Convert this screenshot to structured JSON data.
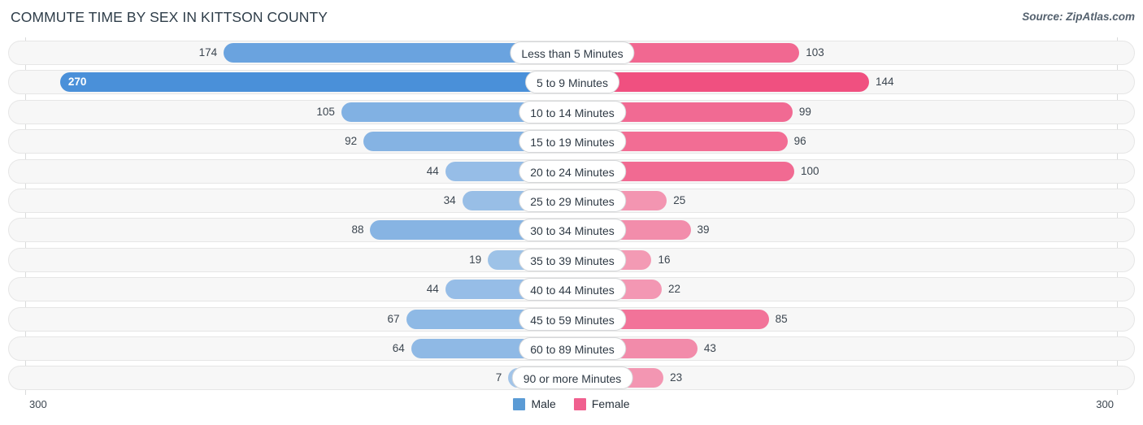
{
  "header": {
    "title": "COMMUTE TIME BY SEX IN KITTSON COUNTY",
    "source": "Source: ZipAtlas.com"
  },
  "axis": {
    "left_max": "300",
    "right_max": "300"
  },
  "legend": {
    "items": [
      {
        "label": "Male",
        "color": "#5b9bd5"
      },
      {
        "label": "Female",
        "color": "#f0608f"
      }
    ]
  },
  "chart_data": {
    "type": "bar",
    "title": "COMMUTE TIME BY SEX IN KITTSON COUNTY",
    "subtitle": "Source: ZipAtlas.com",
    "orientation": "horizontal-diverging",
    "xlabel": "",
    "ylabel": "",
    "xlim": [
      -300,
      300
    ],
    "axis_max": 300,
    "grid": false,
    "legend_position": "bottom-center",
    "categories": [
      "Less than 5 Minutes",
      "5 to 9 Minutes",
      "10 to 14 Minutes",
      "15 to 19 Minutes",
      "20 to 24 Minutes",
      "25 to 29 Minutes",
      "30 to 34 Minutes",
      "35 to 39 Minutes",
      "40 to 44 Minutes",
      "45 to 59 Minutes",
      "60 to 89 Minutes",
      "90 or more Minutes"
    ],
    "series": [
      {
        "name": "Male",
        "color": "#5b9bd5",
        "values": [
          174,
          270,
          105,
          92,
          44,
          34,
          88,
          19,
          44,
          67,
          64,
          7
        ]
      },
      {
        "name": "Female",
        "color": "#f0608f",
        "values": [
          103,
          144,
          99,
          96,
          100,
          25,
          39,
          16,
          22,
          85,
          43,
          23
        ]
      }
    ]
  },
  "rows": [
    {
      "label": "Less than 5 Minutes",
      "male": 174,
      "female": 103,
      "male_text": "174",
      "female_text": "103",
      "male_inside": false
    },
    {
      "label": "5 to 9 Minutes",
      "male": 270,
      "female": 144,
      "male_text": "270",
      "female_text": "144",
      "male_inside": true
    },
    {
      "label": "10 to 14 Minutes",
      "male": 105,
      "female": 99,
      "male_text": "105",
      "female_text": "99",
      "male_inside": false
    },
    {
      "label": "15 to 19 Minutes",
      "male": 92,
      "female": 96,
      "male_text": "92",
      "female_text": "96",
      "male_inside": false
    },
    {
      "label": "20 to 24 Minutes",
      "male": 44,
      "female": 100,
      "male_text": "44",
      "female_text": "100",
      "male_inside": false
    },
    {
      "label": "25 to 29 Minutes",
      "male": 34,
      "female": 25,
      "male_text": "34",
      "female_text": "25",
      "male_inside": false
    },
    {
      "label": "30 to 34 Minutes",
      "male": 88,
      "female": 39,
      "male_text": "88",
      "female_text": "39",
      "male_inside": false
    },
    {
      "label": "35 to 39 Minutes",
      "male": 19,
      "female": 16,
      "male_text": "19",
      "female_text": "16",
      "male_inside": false
    },
    {
      "label": "40 to 44 Minutes",
      "male": 44,
      "female": 22,
      "male_text": "44",
      "female_text": "22",
      "male_inside": false
    },
    {
      "label": "45 to 59 Minutes",
      "male": 67,
      "female": 85,
      "male_text": "67",
      "female_text": "85",
      "male_inside": false
    },
    {
      "label": "60 to 89 Minutes",
      "male": 64,
      "female": 43,
      "male_text": "64",
      "female_text": "43",
      "male_inside": false
    },
    {
      "label": "90 or more Minutes",
      "male": 7,
      "female": 23,
      "male_text": "7",
      "female_text": "23",
      "male_inside": false
    }
  ]
}
